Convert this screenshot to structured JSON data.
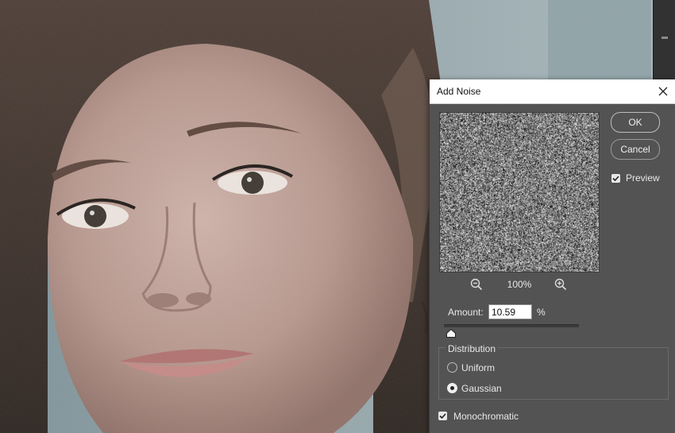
{
  "dialog": {
    "title": "Add Noise",
    "ok_label": "OK",
    "cancel_label": "Cancel",
    "preview_label": "Preview",
    "preview_checked": true,
    "zoom_level": "100%",
    "zoom_out_icon": "zoom-out-icon",
    "zoom_in_icon": "zoom-in-icon",
    "close_icon": "close-icon",
    "amount_label": "Amount:",
    "amount_value": "10.59",
    "amount_unit": "%",
    "amount_slider_fraction": 0.053,
    "distribution": {
      "legend": "Distribution",
      "options": [
        "Uniform",
        "Gaussian"
      ],
      "selected": "Gaussian"
    },
    "monochromatic_label": "Monochromatic",
    "monochromatic_checked": true
  },
  "colors": {
    "dialog_bg": "#535353",
    "titlebar_bg": "#ffffff",
    "text": "#e8e8e8"
  }
}
